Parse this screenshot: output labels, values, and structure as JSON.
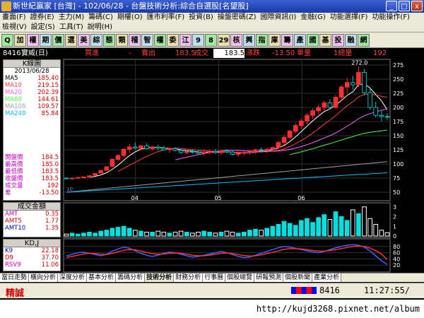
{
  "window": {
    "title": "新世紀贏家 [台灣] - 102/06/28 - 台盤技術分析:綜合自選股[名望股]",
    "min": "_",
    "max": "□",
    "close": "x"
  },
  "menu": {
    "row1": [
      "畫面(F)",
      "證券(E)",
      "主力(M)",
      "籌碼(C)",
      "期權(O)",
      "匯市利率(F)",
      "投資(B)",
      "操盤密碼(Z)",
      "國際資訊(I)",
      "金融(G)",
      "功能選擇(F)",
      "功能操作(F)"
    ],
    "row2": [
      "檢視(V)",
      "設定(S)",
      "工具(T)",
      "說明(H)"
    ]
  },
  "toolbar": [
    "Q",
    "加",
    "權",
    "期",
    "價",
    "選",
    "美",
    "綜",
    "態",
    "類",
    "稽",
    "智",
    "權",
    "委",
    "江",
    "9",
    "8",
    "29",
    "核",
    "興",
    "指",
    "庫",
    "籌",
    "產",
    "國",
    "基",
    "投",
    "融",
    "網"
  ],
  "info": {
    "code": "8416",
    "name": "實威(日)",
    "buy": "買進",
    "buy_val": "-",
    "sell": "賣出",
    "sell_val": "183.5",
    "trade": "成交",
    "trade_val": "183.5",
    "change_label": "漲跌",
    "change_val": "-13.50",
    "vol_label": "單量",
    "vol_unit": "1總量",
    "total": "192"
  },
  "kpanel": {
    "title": "K線圖",
    "date": "2013/06/28",
    "ma": [
      {
        "name": "MA5",
        "value": "185.40",
        "color": "#ffffff"
      },
      {
        "name": "MA10",
        "value": "219.15",
        "color": "#ff4040"
      },
      {
        "name": "MA20",
        "value": "202.39",
        "color": "#ff60ff"
      },
      {
        "name": "MA60",
        "value": "144.61",
        "color": "#40ff40"
      },
      {
        "name": "MA108",
        "value": "109.57",
        "color": "#a0a0a0"
      },
      {
        "name": "MA240",
        "value": "85.84",
        "color": "#00c0ff"
      }
    ],
    "prices": [
      {
        "label": "開盤價",
        "value": "184.5"
      },
      {
        "label": "最高價",
        "value": "185.0"
      },
      {
        "label": "最低價",
        "value": "183.5"
      },
      {
        "label": "收盤價",
        "value": "183.5"
      },
      {
        "label": "成交量",
        "value": "192"
      },
      {
        "label": "差",
        "value": "-13.50"
      }
    ],
    "peak": "272.0",
    "yticks": [
      "275",
      "250",
      "225",
      "200",
      "175",
      "150",
      "125",
      "100",
      "75",
      "50"
    ],
    "xticks": [
      "04",
      "05",
      "06"
    ],
    "axis_label": "10"
  },
  "vol_panel": {
    "title": "成交金額",
    "rows": [
      {
        "name": "AMT",
        "value": "0.35"
      },
      {
        "name": "AMT5",
        "value": "1.77"
      },
      {
        "name": "AMT10",
        "value": "1.35"
      }
    ],
    "yticks": [
      "3",
      "2",
      "1",
      "0"
    ]
  },
  "kd_panel": {
    "title": "KD,J",
    "rows": [
      {
        "name": "K9",
        "value": "22.18"
      },
      {
        "name": "D9",
        "value": "37.70"
      },
      {
        "name": "RSV9",
        "value": "11.06"
      }
    ],
    "yticks": [
      "80",
      "60",
      "40",
      "20"
    ]
  },
  "tabs": [
    "當日走勢",
    "橫向分析",
    "深度分析",
    "基本分析",
    "籌碼分析",
    "技術分析",
    "財務分析",
    "行事曆",
    "個股總覽",
    "研報預測",
    "個股新聞",
    "產業分析"
  ],
  "active_tab": "技術分析",
  "status": {
    "brand": "精誠",
    "code": "8416",
    "clock": "11:27:55/"
  },
  "url": "http://kujd3268.pixnet.net/album",
  "chart_data": {
    "type": "candlestick",
    "x_ticks": [
      "04",
      "05",
      "06"
    ],
    "ylim": [
      50,
      280
    ],
    "peak_label": 272.0,
    "candles": [
      [
        75,
        76,
        73,
        74
      ],
      [
        74,
        75,
        72,
        75
      ],
      [
        75,
        77,
        74,
        76
      ],
      [
        76,
        78,
        75,
        77
      ],
      [
        77,
        80,
        76,
        79
      ],
      [
        80,
        84,
        79,
        83
      ],
      [
        84,
        90,
        83,
        88
      ],
      [
        89,
        96,
        88,
        95
      ],
      [
        96,
        110,
        94,
        108
      ],
      [
        108,
        118,
        105,
        115
      ],
      [
        115,
        128,
        112,
        126
      ],
      [
        126,
        135,
        120,
        130
      ],
      [
        130,
        138,
        126,
        128
      ],
      [
        128,
        134,
        124,
        132
      ],
      [
        132,
        136,
        126,
        127
      ],
      [
        127,
        132,
        124,
        130
      ],
      [
        130,
        134,
        125,
        128
      ],
      [
        128,
        132,
        123,
        125
      ],
      [
        125,
        129,
        120,
        127
      ],
      [
        127,
        130,
        122,
        124
      ],
      [
        124,
        128,
        118,
        120
      ],
      [
        120,
        124,
        116,
        122
      ],
      [
        122,
        126,
        118,
        121
      ],
      [
        121,
        125,
        117,
        119
      ],
      [
        119,
        123,
        115,
        121
      ],
      [
        121,
        125,
        117,
        122
      ],
      [
        122,
        126,
        118,
        120
      ],
      [
        120,
        124,
        116,
        123
      ],
      [
        123,
        126,
        119,
        121
      ],
      [
        121,
        124,
        115,
        117
      ],
      [
        117,
        121,
        113,
        119
      ],
      [
        119,
        123,
        115,
        120
      ],
      [
        120,
        124,
        116,
        122
      ],
      [
        122,
        127,
        118,
        125
      ],
      [
        125,
        129,
        120,
        124
      ],
      [
        124,
        128,
        119,
        126
      ],
      [
        126,
        131,
        122,
        129
      ],
      [
        129,
        140,
        126,
        138
      ],
      [
        138,
        150,
        134,
        147
      ],
      [
        147,
        160,
        143,
        158
      ],
      [
        158,
        172,
        154,
        168
      ],
      [
        168,
        180,
        162,
        176
      ],
      [
        176,
        190,
        170,
        186
      ],
      [
        186,
        198,
        180,
        194
      ],
      [
        194,
        205,
        188,
        200
      ],
      [
        200,
        212,
        194,
        208
      ],
      [
        208,
        215,
        196,
        200
      ],
      [
        200,
        222,
        198,
        218
      ],
      [
        218,
        240,
        212,
        236
      ],
      [
        236,
        252,
        226,
        244
      ],
      [
        244,
        256,
        232,
        240
      ],
      [
        240,
        272,
        236,
        262
      ],
      [
        262,
        268,
        222,
        226
      ],
      [
        226,
        236,
        196,
        200
      ],
      [
        200,
        210,
        182,
        186
      ],
      [
        186,
        194,
        176,
        184
      ],
      [
        184,
        190,
        178,
        183.5
      ]
    ],
    "volume": [
      0.2,
      0.3,
      0.2,
      0.3,
      0.4,
      0.3,
      0.5,
      0.6,
      0.8,
      0.9,
      1.0,
      0.8,
      0.6,
      0.5,
      0.4,
      0.4,
      0.5,
      0.4,
      0.3,
      0.4,
      0.5,
      0.4,
      0.3,
      0.4,
      0.5,
      0.4,
      0.3,
      0.4,
      0.5,
      0.4,
      0.3,
      0.4,
      0.6,
      0.7,
      0.6,
      0.8,
      1.0,
      1.2,
      1.5,
      1.3,
      1.1,
      1.6,
      1.8,
      1.4,
      1.9,
      2.2,
      1.7,
      2.5,
      2.0,
      1.6,
      2.7,
      2.3,
      3.0,
      1.8,
      1.2,
      0.6,
      0.35
    ],
    "k": [
      50,
      55,
      60,
      62,
      58,
      54,
      50,
      55,
      65,
      72,
      78,
      74,
      66,
      58,
      52,
      48,
      52,
      58,
      62,
      60,
      55,
      50,
      46,
      48,
      52,
      56,
      60,
      64,
      60,
      54,
      48,
      44,
      46,
      52,
      58,
      64,
      70,
      76,
      80,
      78,
      74,
      70,
      66,
      62,
      60,
      64,
      70,
      76,
      80,
      84,
      86,
      84,
      78,
      66,
      50,
      34,
      22.18
    ],
    "d": [
      45,
      48,
      52,
      56,
      58,
      57,
      55,
      54,
      58,
      63,
      68,
      70,
      69,
      65,
      61,
      57,
      55,
      56,
      58,
      59,
      58,
      55,
      52,
      50,
      50,
      52,
      55,
      58,
      59,
      57,
      54,
      51,
      49,
      50,
      53,
      57,
      61,
      66,
      71,
      73,
      73,
      72,
      70,
      67,
      65,
      65,
      67,
      70,
      73,
      77,
      80,
      81,
      80,
      75,
      67,
      56,
      37.7
    ]
  }
}
